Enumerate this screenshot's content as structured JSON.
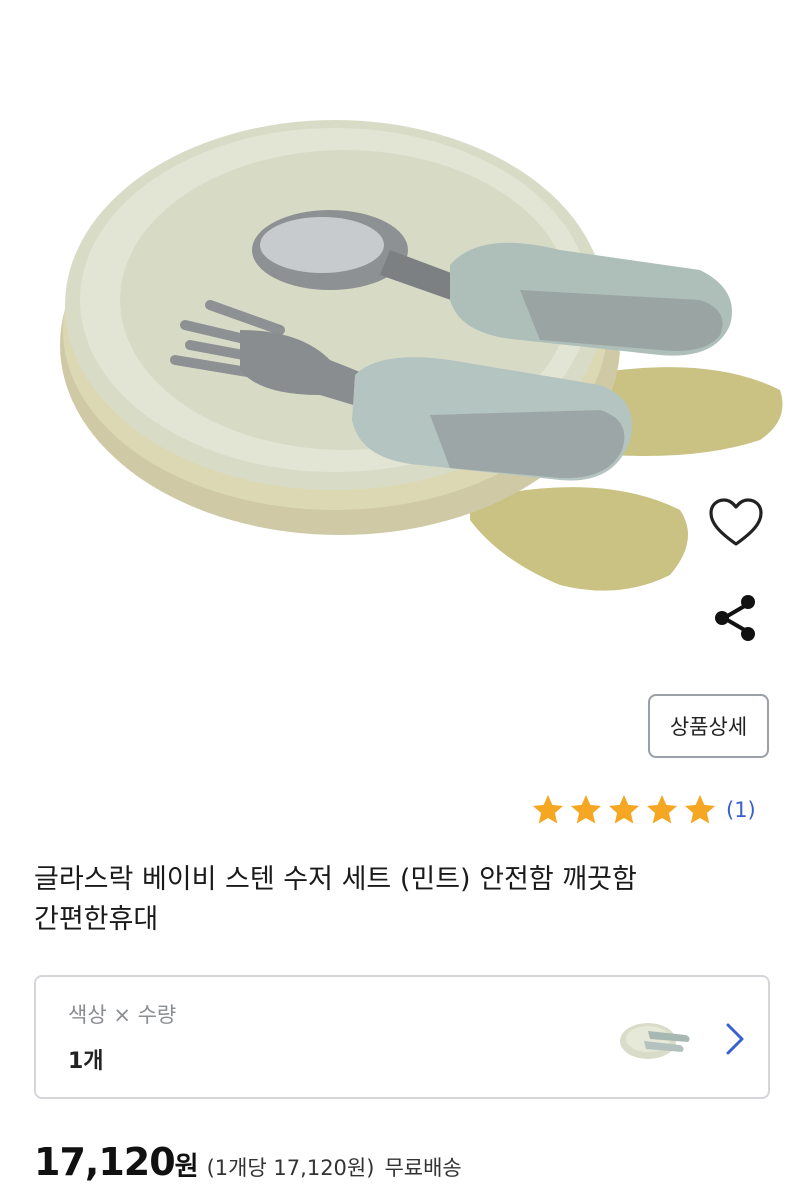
{
  "product": {
    "image_icon": "product-photo-plate-spoon-fork",
    "title_line1": "글라스락 베이비 스텐 수저 세트 (민트) 안전함 깨끗함",
    "title_line2": "간편한휴대"
  },
  "actions": {
    "favorite_icon": "heart-outline-icon",
    "share_icon": "share-icon",
    "detail_button": "상품상세"
  },
  "rating": {
    "stars": 5,
    "max_stars": 5,
    "review_count": "(1)",
    "star_color": "#f5a623"
  },
  "option": {
    "label": "색상 × 수량",
    "value": "1개",
    "thumb_icon": "product-thumbnail",
    "chevron_icon": "chevron-right-icon",
    "chevron_color": "#3a5fd0"
  },
  "pricing": {
    "price": "17,120",
    "currency": "원",
    "unit_price": "(1개당 17,120원)",
    "shipping": "무료배송"
  }
}
